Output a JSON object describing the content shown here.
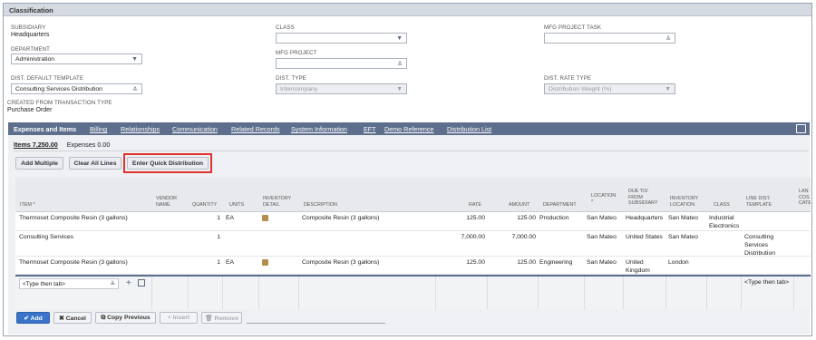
{
  "section": {
    "title": "Classification"
  },
  "fields": {
    "subsidiary": {
      "label": "SUBSIDIARY",
      "value": "Headquarters"
    },
    "department": {
      "label": "DEPARTMENT",
      "value": "Administration"
    },
    "dist_default_template": {
      "label": "DIST. DEFAULT TEMPLATE",
      "value": "Consulting Services Distribution"
    },
    "created_from": {
      "label": "CREATED FROM TRANSACTION TYPE",
      "value": "Purchase Order"
    },
    "class": {
      "label": "CLASS",
      "value": ""
    },
    "mfg_project": {
      "label": "MFG PROJECT",
      "value": ""
    },
    "dist_type": {
      "label": "DIST. TYPE",
      "value": "Intercompany"
    },
    "mfg_project_task": {
      "label": "MFG PROJECT TASK",
      "value": ""
    },
    "dist_rate_type": {
      "label": "DIST. RATE TYPE",
      "value": "Distribution Weight (%)"
    }
  },
  "tabs": [
    "Expenses and Items",
    "Billing",
    "Relationships",
    "Communication",
    "Related Records",
    "System Information",
    "EFT",
    "Demo Reference",
    "Distribution List"
  ],
  "subtabs": {
    "items": "Items 7,250.00",
    "expenses": "Expenses 0.00"
  },
  "buttons": {
    "add_multiple": "Add Multiple",
    "clear_all": "Clear All Lines",
    "quick_dist": "Enter Quick Distribution"
  },
  "columns": [
    "ITEM *",
    "VENDOR NAME",
    "QUANTITY",
    "UNITS",
    "INVENTORY DETAIL",
    "DESCRIPTION",
    "RATE",
    "AMOUNT",
    "DEPARTMENT",
    "LOCATION *",
    "DUE TO/ FROM SUBSIDIARY",
    "INVENTORY LOCATION",
    "CLASS",
    "LINE DIST. TEMPLATE",
    "LAN COS CATE"
  ],
  "rows": [
    {
      "item": "Thermoset Composite Resin (3 gallons)",
      "quantity": "1",
      "units": "EA",
      "description": "Composite Resin (3 gallons)",
      "rate": "125.00",
      "amount": "125.00",
      "department": "Production",
      "location": "San Mateo",
      "due": "Headquarters",
      "inv_location": "San Mateo",
      "class": "Industrial Electronics",
      "template": ""
    },
    {
      "item": "Consulting Services",
      "quantity": "1",
      "units": "",
      "description": "",
      "rate": "7,000.00",
      "amount": "7,000.00",
      "department": "",
      "location": "San Mateo",
      "due": "United States",
      "inv_location": "San Mateo",
      "class": "",
      "template": "Consulting Services Distribution"
    },
    {
      "item": "Thermoset Composite Resin (3 gallons)",
      "quantity": "1",
      "units": "EA",
      "description": "Composite Resin (3 gallons)",
      "rate": "125.00",
      "amount": "125.00",
      "department": "Engineering",
      "location": "San Mateo",
      "due": "United Kingdom",
      "inv_location": "London",
      "class": "",
      "template": ""
    }
  ],
  "edit_row": {
    "item_placeholder": "<Type then tab>",
    "template_placeholder": "<Type then tab>"
  },
  "footer": {
    "add": "Add",
    "cancel": "Cancel",
    "copy": "Copy Previous",
    "insert": "Insert",
    "remove": "Remove"
  }
}
